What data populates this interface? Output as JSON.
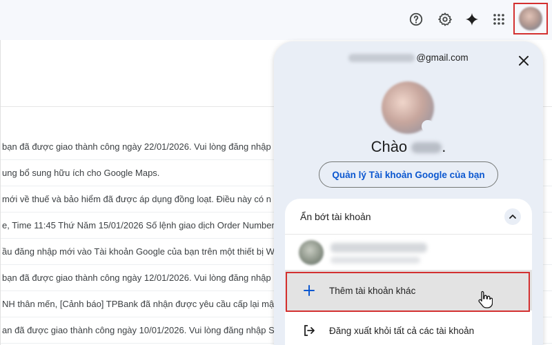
{
  "mail_rows": [
    {
      "text": "bạn đã được giao thành công ngày 22/01/2026. Vui lòng đăng nhập"
    },
    {
      "text": "ung bổ sung hữu ích cho Google Maps."
    },
    {
      "text": "mới về thuế và bảo hiểm đã được áp dụng đồng loạt. Điều này có n"
    },
    {
      "text": "e, Time 11:45 Thứ Năm 15/01/2026 Số lệnh giao dịch Order Number"
    },
    {
      "text": "ầu đăng nhập mới vào Tài khoản Google của bạn trên một thiết bị W"
    },
    {
      "text": "bạn đã được giao thành công ngày 12/01/2026. Vui lòng đăng nhập"
    },
    {
      "text": "NH thân mến, [Cảnh báo] TPBank đã nhận được yêu cầu cấp lại mậ"
    },
    {
      "text": "an đã được giao thành công ngày 10/01/2026. Vui lòng đăng nhập S"
    }
  ],
  "account_panel": {
    "email_suffix": "@gmail.com",
    "greeting": "Chào",
    "manage_button": "Quản lý Tài khoản Google của bạn",
    "accounts_header": "Ẩn bớt tài khoản",
    "add_account": "Thêm tài khoản khác",
    "sign_out_all": "Đăng xuất khỏi tất cả các tài khoản"
  },
  "icons": {
    "help": "help-icon",
    "settings": "gear-icon",
    "gemini": "sparkle-icon",
    "apps": "apps-grid-icon",
    "close": "close-icon",
    "collapse": "chevron-up-icon",
    "add": "plus-icon",
    "signout": "logout-icon",
    "cursor": "hand-cursor-icon"
  },
  "colors": {
    "accent_blue": "#0b57d0",
    "highlight_red": "#d32f2f",
    "panel_bg": "#e9eef6"
  }
}
